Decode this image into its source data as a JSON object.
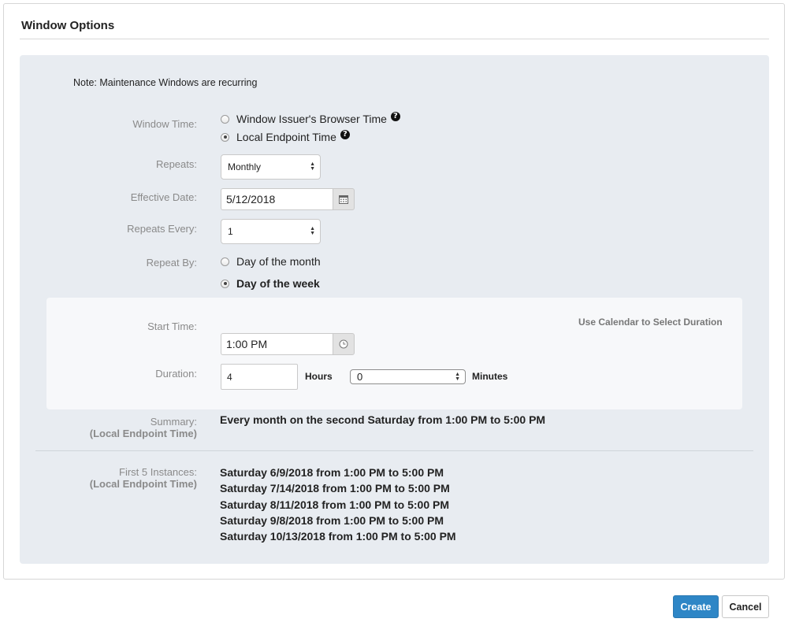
{
  "panel": {
    "title": "Window Options"
  },
  "note": "Note: Maintenance Windows are recurring",
  "window_time": {
    "label": "Window Time:",
    "options": [
      {
        "label": "Window Issuer's Browser Time",
        "checked": false
      },
      {
        "label": "Local Endpoint Time",
        "checked": true
      }
    ],
    "help_glyph": "?"
  },
  "repeats": {
    "label": "Repeats:",
    "value": "Monthly"
  },
  "effective_date": {
    "label": "Effective Date:",
    "value": "5/12/2018",
    "icon": "calendar-icon"
  },
  "repeats_every": {
    "label": "Repeats Every:",
    "value": "1"
  },
  "repeat_by": {
    "label": "Repeat By:",
    "options": [
      {
        "label": "Day of the month",
        "checked": false
      },
      {
        "label": "Day of the week",
        "checked": true
      }
    ]
  },
  "duration_panel": {
    "calendar_link": "Use Calendar to Select Duration",
    "start_time": {
      "label": "Start Time:",
      "value": "1:00 PM",
      "icon": "clock-icon"
    },
    "duration": {
      "label": "Duration:",
      "hours_value": "4",
      "hours_unit": "Hours",
      "minutes_value": "0",
      "minutes_unit": "Minutes"
    }
  },
  "summary": {
    "label": "Summary:",
    "sublabel": "(Local Endpoint Time)",
    "text": "Every month on the second Saturday from 1:00 PM to 5:00 PM"
  },
  "instances": {
    "label": "First 5 Instances:",
    "sublabel": "(Local Endpoint Time)",
    "items": [
      "Saturday 6/9/2018 from 1:00 PM to 5:00 PM",
      "Saturday 7/14/2018 from 1:00 PM to 5:00 PM",
      "Saturday 8/11/2018 from 1:00 PM to 5:00 PM",
      "Saturday 9/8/2018 from 1:00 PM to 5:00 PM",
      "Saturday 10/13/2018 from 1:00 PM to 5:00 PM"
    ]
  },
  "footer": {
    "create_label": "Create",
    "cancel_label": "Cancel"
  },
  "colors": {
    "primary": "#2e86c6",
    "inner_bg": "#e8ecf1",
    "label_gray": "#8a8a8a"
  }
}
